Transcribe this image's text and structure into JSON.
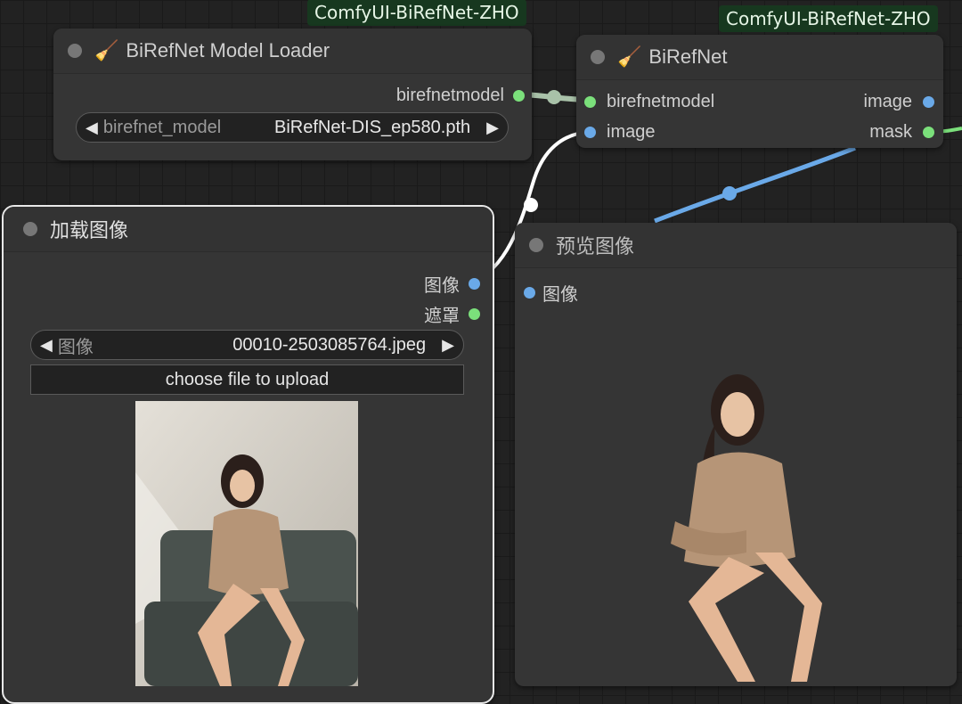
{
  "badges": {
    "loader_badge": "ComfyUI-BiRefNet-ZHO",
    "birefnet_badge": "ComfyUI-BiRefNet-ZHO"
  },
  "model_loader": {
    "title": "BiRefNet Model Loader",
    "title_icon": "broom-icon",
    "output": "birefnetmodel",
    "widget": {
      "label": "birefnet_model",
      "value": "BiRefNet-DIS_ep580.pth"
    }
  },
  "birefnet": {
    "title": "BiRefNet",
    "title_icon": "broom-icon",
    "inputs": [
      "birefnetmodel",
      "image"
    ],
    "outputs": [
      "image",
      "mask"
    ]
  },
  "load_image": {
    "title": "加载图像",
    "outputs": [
      "图像",
      "遮罩"
    ],
    "widget": {
      "label": "图像",
      "value": "00010-2503085764.jpeg"
    },
    "upload_label": "choose file to upload"
  },
  "preview_image": {
    "title": "预览图像",
    "input": "图像"
  },
  "colors": {
    "model_socket": "#7be07b",
    "image_socket": "#6aa9e8",
    "badge_bg": "#17381f",
    "node_bg": "#353535"
  }
}
